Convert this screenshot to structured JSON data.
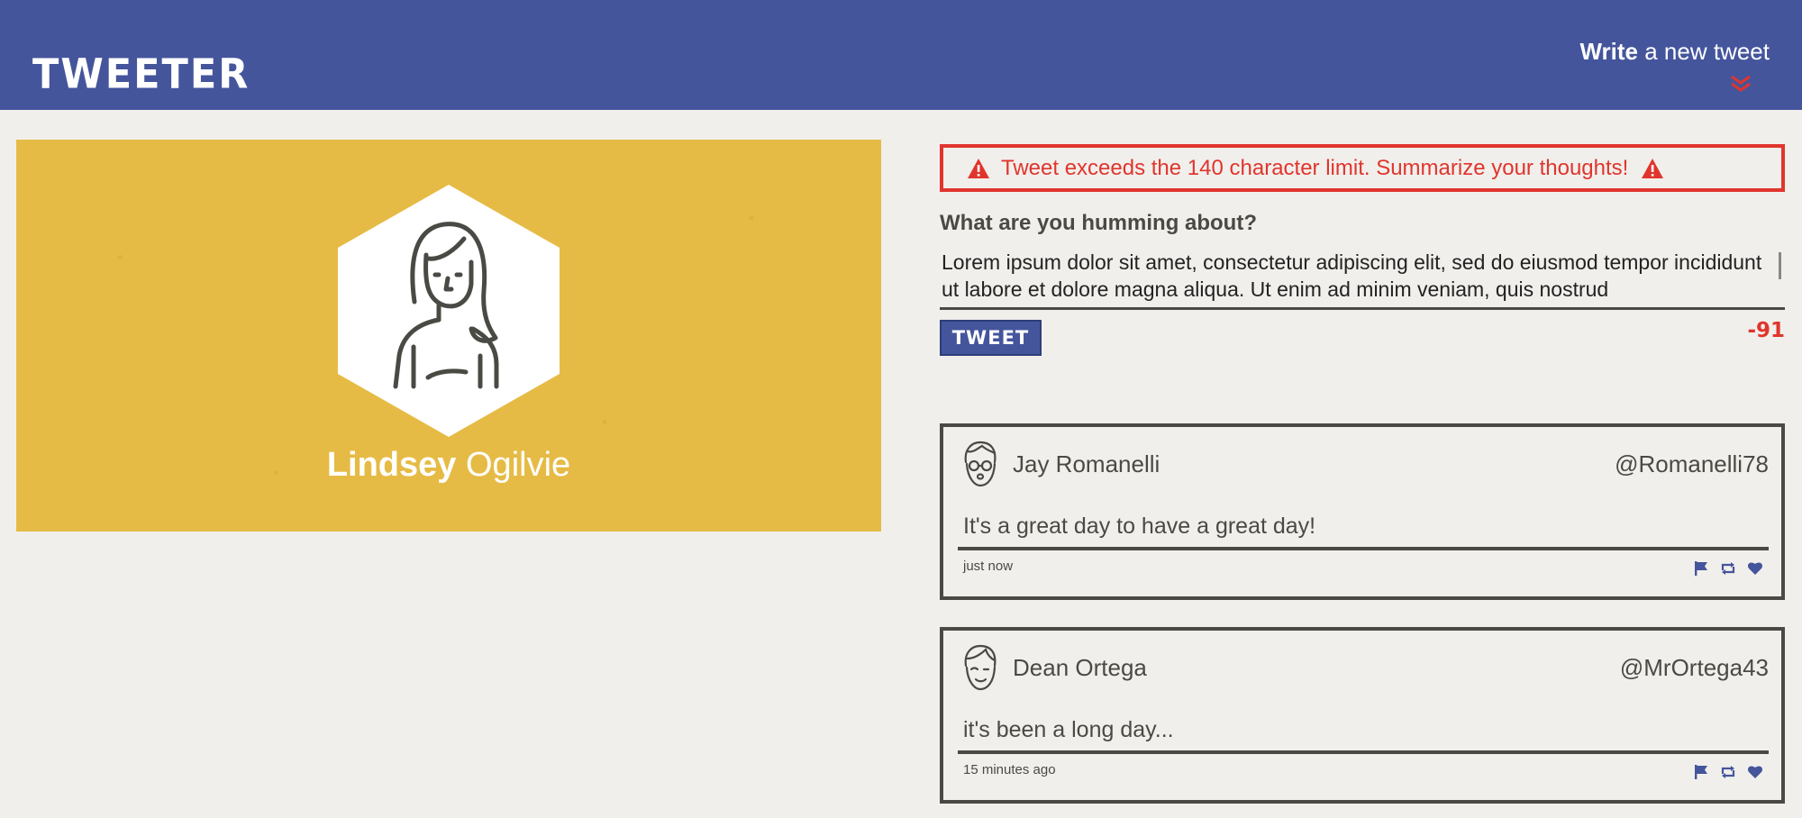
{
  "header": {
    "brand": "TWEETER",
    "compose_bold": "Write",
    "compose_rest": " a new tweet",
    "chevron_icon": "double-chevron-down-icon"
  },
  "colors": {
    "header_bg": "#44559c",
    "accent": "#44559c",
    "error": "#e0352d",
    "profile_bg": "#e6bb45",
    "page_bg": "#f1efeb",
    "text": "#4a4a44"
  },
  "profile": {
    "first_name": "Lindsey",
    "last_name": "Ogilvie",
    "avatar_icon": "woman-avatar-icon"
  },
  "compose": {
    "error_message": "Tweet exceeds the 140 character limit. Summarize your thoughts!",
    "error_icon": "warning-triangle-icon",
    "prompt": "What are you humming about?",
    "textarea_value": "Lorem ipsum dolor sit amet, consectetur adipiscing elit, sed do eiusmod tempor incididunt ut labore et dolore magna aliqua. Ut enim ad minim veniam, quis nostrud",
    "button_label": "TWEET",
    "counter": "-91"
  },
  "tweets": [
    {
      "author": "Jay Romanelli",
      "handle": "@Romanelli78",
      "content": "It's a great day to have a great day!",
      "time": "just now",
      "avatar_icon": "man-with-glasses-avatar-icon"
    },
    {
      "author": "Dean Ortega",
      "handle": "@MrOrtega43",
      "content": "it's been a long day...",
      "time": "15 minutes ago",
      "avatar_icon": "man-avatar-icon"
    }
  ],
  "tweet_actions": [
    "flag-icon",
    "retweet-icon",
    "heart-icon"
  ]
}
